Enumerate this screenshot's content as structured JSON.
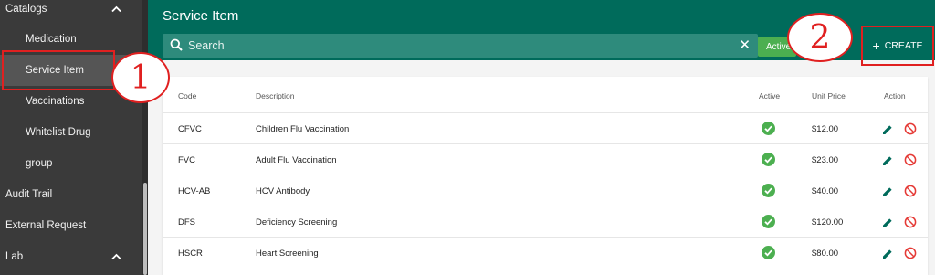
{
  "sidebar": {
    "items": [
      {
        "label": "Catalogs",
        "level": "top",
        "expanded": true
      },
      {
        "label": "Medication",
        "level": "sub"
      },
      {
        "label": "Service Item",
        "level": "sub",
        "active": true
      },
      {
        "label": "Vaccinations",
        "level": "sub"
      },
      {
        "label": "Whitelist Drug",
        "level": "sub"
      },
      {
        "label": "group",
        "level": "sub"
      },
      {
        "label": "Audit Trail",
        "level": "top"
      },
      {
        "label": "External Request",
        "level": "top"
      },
      {
        "label": "Lab",
        "level": "top",
        "expanded": true
      }
    ]
  },
  "header": {
    "title": "Service Item",
    "search_placeholder": "Search",
    "active_filter_label": "Active",
    "create_label": "CREATE"
  },
  "annotations": {
    "step1": "1",
    "step2": "2"
  },
  "table": {
    "columns": {
      "code": "Code",
      "description": "Description",
      "active": "Active",
      "unit_price": "Unit Price",
      "action": "Action"
    },
    "rows": [
      {
        "code": "CFVC",
        "description": "Children Flu Vaccination",
        "active": true,
        "unit_price": "$12.00"
      },
      {
        "code": "FVC",
        "description": "Adult Flu Vaccination",
        "active": true,
        "unit_price": "$23.00"
      },
      {
        "code": "HCV-AB",
        "description": "HCV Antibody",
        "active": true,
        "unit_price": "$40.00"
      },
      {
        "code": "DFS",
        "description": "Deficiency Screening",
        "active": true,
        "unit_price": "$120.00"
      },
      {
        "code": "HSCR",
        "description": "Heart Screening",
        "active": true,
        "unit_price": "$80.00"
      }
    ]
  },
  "colors": {
    "header_bg": "#006b5b",
    "search_bg": "#2e8b7c",
    "sidebar_bg": "#3a3a3a",
    "active_green": "#4caf50",
    "edit_icon": "#006b5b",
    "cancel_icon": "#e53935",
    "annotation_red": "#e02020"
  },
  "icons": {
    "search": "search-icon",
    "clear": "close-icon",
    "chevron": "chevron-up-icon",
    "active": "check-circle-icon",
    "edit": "pencil-icon",
    "cancel": "block-icon",
    "create": "plus-icon"
  }
}
